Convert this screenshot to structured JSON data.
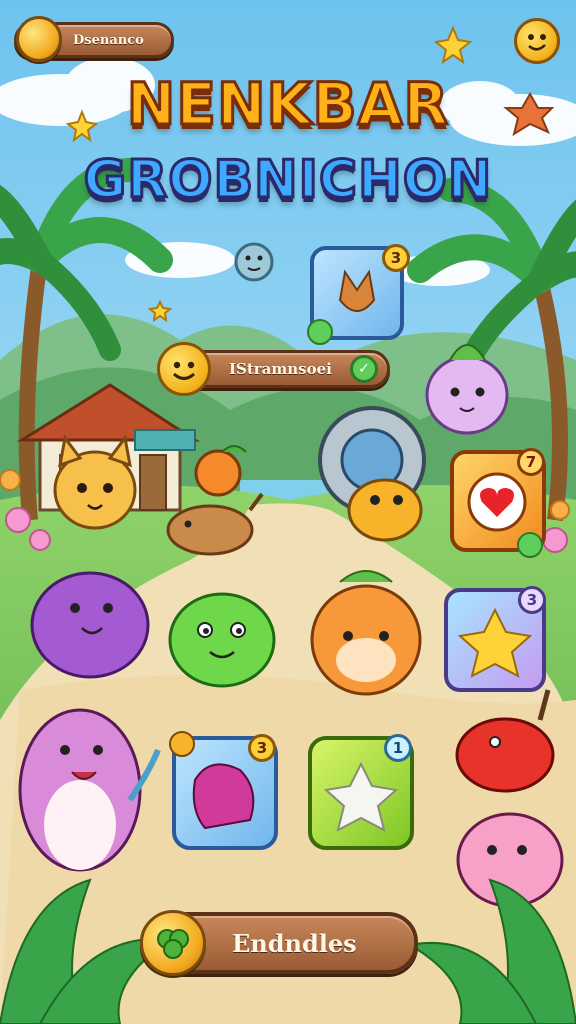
{
  "header": {
    "profile_label": "Dsenanco",
    "title_line1": "NENKBAR",
    "title_line2": "GROBNICHON"
  },
  "quest_bar": {
    "label": "IStramnsoei",
    "badge": "✓"
  },
  "cards": [
    {
      "name": "cat-card",
      "badge": "3"
    },
    {
      "name": "heart-card",
      "badge": "7"
    },
    {
      "name": "star-card",
      "badge": "3"
    },
    {
      "name": "monster-card",
      "badge": "3"
    },
    {
      "name": "white-star-card",
      "badge": "1"
    }
  ],
  "bottom_button": {
    "label": "Endndles"
  },
  "colors": {
    "button_brown": "#9a5b35",
    "title_orange": "#ffb11a",
    "title_blue": "#3fa8ff",
    "sky": "#8fd3f0",
    "path_sand": "#f1dfb6"
  }
}
